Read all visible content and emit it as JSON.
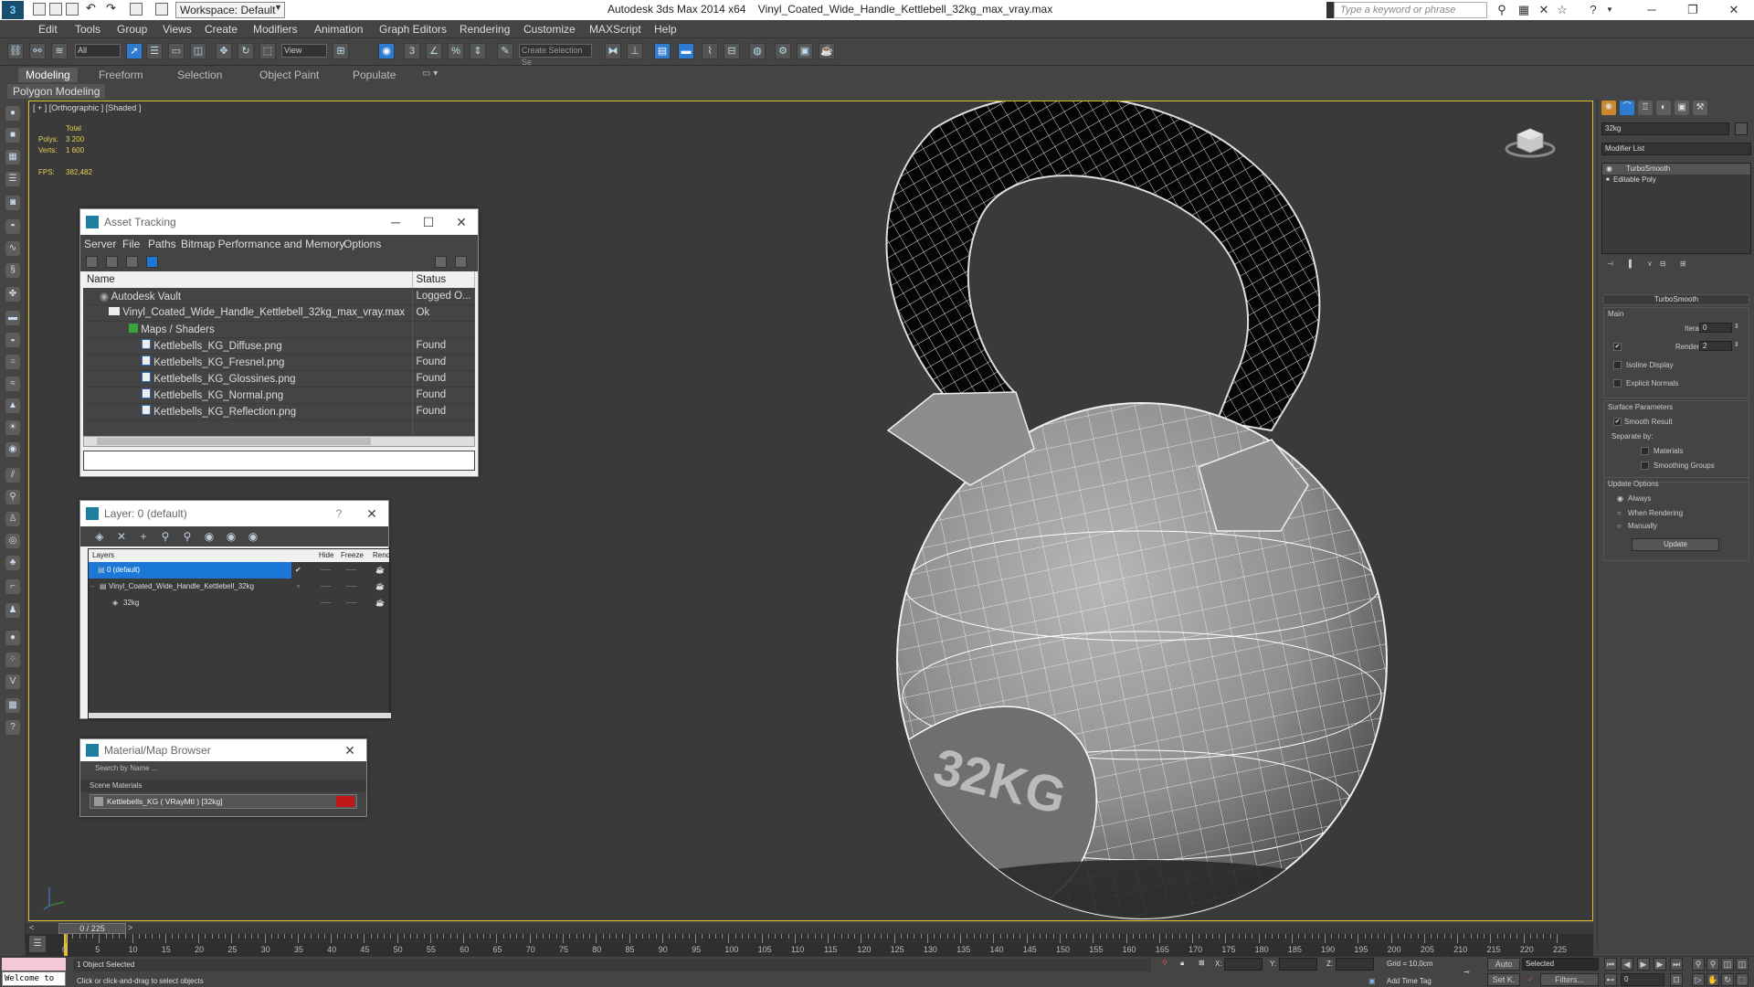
{
  "titlebar": {
    "workspace": "Workspace: Default",
    "app_version": "Autodesk 3ds Max  2014 x64",
    "filename": "Vinyl_Coated_Wide_Handle_Kettlebell_32kg_max_vray.max",
    "search_placeholder": "Type a keyword or phrase"
  },
  "menubar": {
    "items": [
      "Edit",
      "Tools",
      "Group",
      "Views",
      "Create",
      "Modifiers",
      "Animation",
      "Graph Editors",
      "Rendering",
      "Customize",
      "MAXScript",
      "Help"
    ]
  },
  "toolbar": {
    "filter_value": "All",
    "ref_coord_value": "View",
    "selection_set_placeholder": "Create Selection Se"
  },
  "ribbon": {
    "tabs": [
      "Modeling",
      "Freeform",
      "Selection",
      "Object Paint",
      "Populate"
    ],
    "active_tab": "Modeling",
    "subpanel": "Polygon Modeling"
  },
  "viewport": {
    "label": "[ + ] [Orthographic ] [Shaded ]",
    "stats": {
      "total_label": "Total",
      "polys_label": "Polys:",
      "polys_value": "3 200",
      "verts_label": "Verts:",
      "verts_value": "1 600",
      "fps_label": "FPS:",
      "fps_value": "382,482"
    },
    "model_text": "32KG"
  },
  "asset_tracking": {
    "title": "Asset Tracking",
    "menu": [
      "Server",
      "File",
      "Paths",
      "Bitmap Performance and Memory",
      "Options"
    ],
    "columns": {
      "name": "Name",
      "status": "Status"
    },
    "rows": [
      {
        "name": "Autodesk Vault",
        "status": "Logged O..."
      },
      {
        "name": "Vinyl_Coated_Wide_Handle_Kettlebell_32kg_max_vray.max",
        "status": "Ok"
      },
      {
        "name": "Maps / Shaders",
        "status": ""
      },
      {
        "name": "Kettlebells_KG_Diffuse.png",
        "status": "Found"
      },
      {
        "name": "Kettlebells_KG_Fresnel.png",
        "status": "Found"
      },
      {
        "name": "Kettlebells_KG_Glossines.png",
        "status": "Found"
      },
      {
        "name": "Kettlebells_KG_Normal.png",
        "status": "Found"
      },
      {
        "name": "Kettlebells_KG_Reflection.png",
        "status": "Found"
      }
    ]
  },
  "layer_window": {
    "title": "Layer: 0 (default)",
    "help": "?",
    "columns": {
      "layers": "Layers",
      "hide": "Hide",
      "freeze": "Freeze",
      "render": "Rend"
    },
    "rows": [
      {
        "name": "0 (default)"
      },
      {
        "name": "Vinyl_Coated_Wide_Handle_Kettlebell_32kg"
      },
      {
        "name": "32kg"
      }
    ]
  },
  "material_browser": {
    "title": "Material/Map Browser",
    "search_placeholder": "Search by Name ...",
    "group": "Scene Materials",
    "material": "Kettlebells_KG  ( VRayMtl )  [32kg]"
  },
  "command_panel": {
    "object_name": "32kg",
    "modifier_list": "Modifier List",
    "stack": [
      "TurboSmooth",
      "Editable Poly"
    ],
    "turbosmooth": {
      "title": "TurboSmooth",
      "main": "Main",
      "iterations_label": "Iterations:",
      "iterations_value": "0",
      "render_iters_label": "Render Iters:",
      "render_iters_value": "2",
      "isoline": "Isoline Display",
      "explicit_normals": "Explicit Normals",
      "surface_params": "Surface Parameters",
      "smooth_result": "Smooth Result",
      "separate_by": "Separate by:",
      "materials": "Materials",
      "smoothing_groups": "Smoothing Groups",
      "update_options": "Update Options",
      "always": "Always",
      "when_rendering": "When Rendering",
      "manually": "Manually",
      "update_button": "Update"
    }
  },
  "timeline": {
    "frame_display": "0 / 225",
    "ticks": [
      "0",
      "5",
      "10",
      "15",
      "20",
      "25",
      "30",
      "35",
      "40",
      "45",
      "50",
      "55",
      "60",
      "65",
      "70",
      "75",
      "80",
      "85",
      "90",
      "95",
      "100",
      "105",
      "110",
      "115",
      "120",
      "125",
      "130",
      "135",
      "140",
      "145",
      "150",
      "155",
      "160",
      "165",
      "170",
      "175",
      "180",
      "185",
      "190",
      "195",
      "200",
      "205",
      "210",
      "215",
      "220",
      "225"
    ]
  },
  "status": {
    "maxscript": "Welcome to",
    "selected": "1 Object Selected",
    "prompt": "Click or click-and-drag to select objects",
    "x_label": "X:",
    "y_label": "Y:",
    "z_label": "Z:",
    "grid": "Grid = 10,0cm",
    "add_time_tag": "Add Time Tag",
    "auto": "Auto",
    "set_k": "Set K.",
    "selected_dropdown": "Selected",
    "filters": "Filters...",
    "frame_field": "0"
  },
  "colors": {
    "viewport_bg": "#3a3a3a",
    "active_viewport_border": "#e0c030",
    "selection_blue": "#1b78d6",
    "stats_text": "#e8d050"
  }
}
